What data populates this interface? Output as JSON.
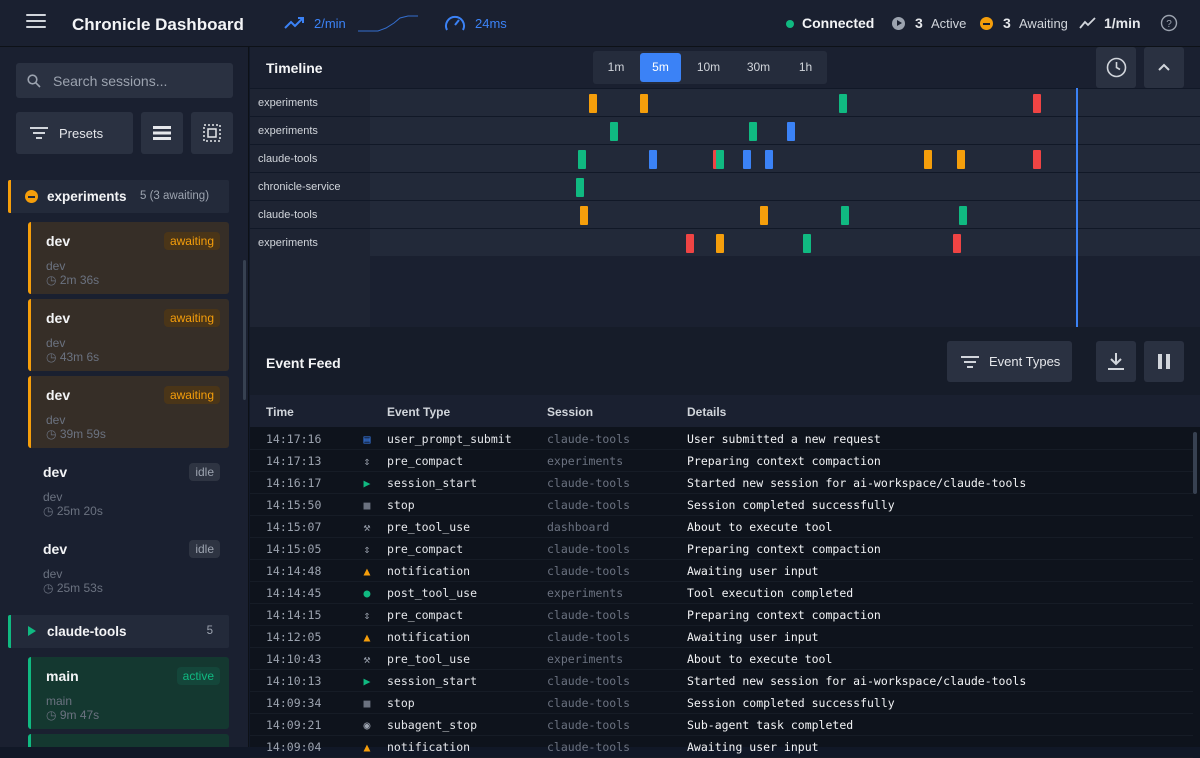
{
  "header": {
    "title": "Chronicle Dashboard",
    "rate": "2/min",
    "latency": "24ms",
    "status": "Connected",
    "active_count": "3",
    "active_label": "Active",
    "awaiting_count": "3",
    "awaiting_label": "Awaiting",
    "event_rate": "1/min"
  },
  "sidebar": {
    "search_placeholder": "Search sessions...",
    "presets_label": "Presets",
    "groups": [
      {
        "name": "experiments",
        "count": "5 (3 awaiting)"
      },
      {
        "name": "claude-tools",
        "count": "5"
      }
    ],
    "sessions": [
      {
        "name": "dev",
        "sub": "dev",
        "time": "2m 36s",
        "badge": "awaiting"
      },
      {
        "name": "dev",
        "sub": "dev",
        "time": "43m 6s",
        "badge": "awaiting"
      },
      {
        "name": "dev",
        "sub": "dev",
        "time": "39m 59s",
        "badge": "awaiting"
      },
      {
        "name": "dev",
        "sub": "dev",
        "time": "25m 20s",
        "badge": "idle"
      },
      {
        "name": "dev",
        "sub": "dev",
        "time": "25m 53s",
        "badge": "idle"
      },
      {
        "name": "main",
        "sub": "main",
        "time": "9m 47s",
        "badge": "active"
      }
    ]
  },
  "timeline": {
    "title": "Timeline",
    "ranges": [
      "1m",
      "5m",
      "10m",
      "30m",
      "1h"
    ],
    "selected_range": "5m",
    "rows": [
      "experiments",
      "experiments",
      "claude-tools",
      "chronicle-service",
      "claude-tools",
      "experiments"
    ]
  },
  "feed": {
    "title": "Event Feed",
    "event_types_label": "Event Types",
    "columns": [
      "Time",
      "Event Type",
      "Session",
      "Details"
    ],
    "events": [
      {
        "time": "14:17:16",
        "type": "user_prompt_submit",
        "session": "claude-tools",
        "details": "User submitted a new request",
        "icon": "chat-icon"
      },
      {
        "time": "14:17:13",
        "type": "pre_compact",
        "session": "experiments",
        "details": "Preparing context compaction",
        "icon": "compress-icon"
      },
      {
        "time": "14:16:17",
        "type": "session_start",
        "session": "claude-tools",
        "details": "Started new session for ai-workspace/claude-tools",
        "icon": "play-icon"
      },
      {
        "time": "14:15:50",
        "type": "stop",
        "session": "claude-tools",
        "details": "Session completed successfully",
        "icon": "stop-icon"
      },
      {
        "time": "14:15:07",
        "type": "pre_tool_use",
        "session": "dashboard",
        "details": "About to execute tool",
        "icon": "wrench-icon"
      },
      {
        "time": "14:15:05",
        "type": "pre_compact",
        "session": "claude-tools",
        "details": "Preparing context compaction",
        "icon": "compress-icon"
      },
      {
        "time": "14:14:48",
        "type": "notification",
        "session": "claude-tools",
        "details": "Awaiting user input",
        "icon": "bell-icon"
      },
      {
        "time": "14:14:45",
        "type": "post_tool_use",
        "session": "experiments",
        "details": "Tool execution completed",
        "icon": "check-icon"
      },
      {
        "time": "14:14:15",
        "type": "pre_compact",
        "session": "claude-tools",
        "details": "Preparing context compaction",
        "icon": "compress-icon"
      },
      {
        "time": "14:12:05",
        "type": "notification",
        "session": "claude-tools",
        "details": "Awaiting user input",
        "icon": "bell-icon"
      },
      {
        "time": "14:10:43",
        "type": "pre_tool_use",
        "session": "experiments",
        "details": "About to execute tool",
        "icon": "wrench-icon"
      },
      {
        "time": "14:10:13",
        "type": "session_start",
        "session": "claude-tools",
        "details": "Started new session for ai-workspace/claude-tools",
        "icon": "play-icon"
      },
      {
        "time": "14:09:34",
        "type": "stop",
        "session": "claude-tools",
        "details": "Session completed successfully",
        "icon": "stop-icon"
      },
      {
        "time": "14:09:21",
        "type": "subagent_stop",
        "session": "claude-tools",
        "details": "Sub-agent task completed",
        "icon": "circle-stop-icon"
      },
      {
        "time": "14:09:04",
        "type": "notification",
        "session": "claude-tools",
        "details": "Awaiting user input",
        "icon": "bell-icon"
      }
    ]
  },
  "colors": {
    "accent": "#3b82f6",
    "awaiting": "#f59e0b",
    "active": "#10b981",
    "stop": "#ef4444"
  }
}
